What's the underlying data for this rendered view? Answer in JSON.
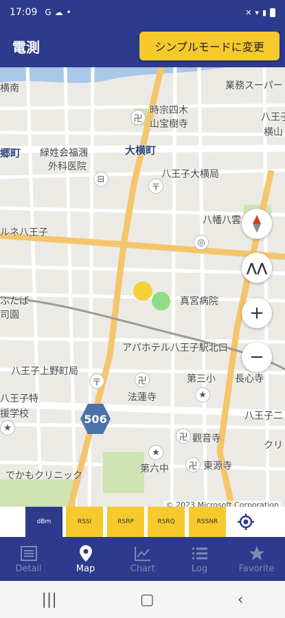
{
  "status_bar": {
    "time": "17:09",
    "icons": [
      "G",
      "cloud-icon",
      "dot-icon"
    ]
  },
  "app_bar": {
    "title": "電測",
    "simple_mode_label": "シンプルモードに変更"
  },
  "map": {
    "labels": {
      "gyomu": "業務スーパー",
      "jisou": "時宗四木",
      "sanpo": "山宝樹寺",
      "hachioji_right": "八王子",
      "yokoyama": "横山",
      "mizuminami": "横南",
      "ryokushi": "緑姓会福涠",
      "geka": "外科医院",
      "odaicho": "大横町",
      "yokomachi_left": "郷町",
      "hachioji_oyoko": "八王子大横局",
      "hachiman": "八幡八雲",
      "lune": "ルネ八王子",
      "futaba": "ふたば",
      "shiba": "司園",
      "shingu": "真宮病院",
      "apa": "アパホテル八王子駅北口",
      "kamino": "八王子上野町局",
      "tokugawa": "八王子特",
      "school": "援学校",
      "daisan": "第三小",
      "nagashin": "長心寺",
      "hasuike": "法蓮寺",
      "kannon": "觀音寺",
      "hachioji2": "八王子二",
      "touge": "東源寺",
      "rokuchu": "第六中",
      "clinic": "でかもクリニック",
      "kuri": "クリ"
    },
    "route_number": "506",
    "copyright": "© 2023 Microsoft Corporation",
    "measurements": [
      {
        "color": "#f2d13b"
      },
      {
        "color": "#8fdc86"
      }
    ]
  },
  "controls": {
    "compass": "compass-icon",
    "tilt": "tilt-icon",
    "zoom_in": "+",
    "zoom_out": "−"
  },
  "metric_tabs": [
    {
      "label": "dBm",
      "active": true
    },
    {
      "label": "RSSI",
      "active": false
    },
    {
      "label": "RSRP",
      "active": false
    },
    {
      "label": "RSRQ",
      "active": false
    },
    {
      "label": "RSSNR",
      "active": false
    }
  ],
  "nav": [
    {
      "label": "Detail",
      "icon": "detail-icon",
      "active": false
    },
    {
      "label": "Map",
      "icon": "map-pin-icon",
      "active": true
    },
    {
      "label": "Chart",
      "icon": "chart-icon",
      "active": false
    },
    {
      "label": "Log",
      "icon": "list-icon",
      "active": false
    },
    {
      "label": "Favorite",
      "icon": "star-icon",
      "active": false
    }
  ],
  "system_nav": [
    "recent-apps-icon",
    "home-icon",
    "back-icon"
  ],
  "colors": {
    "primary": "#2e3a8c",
    "accent": "#f6c92c"
  }
}
